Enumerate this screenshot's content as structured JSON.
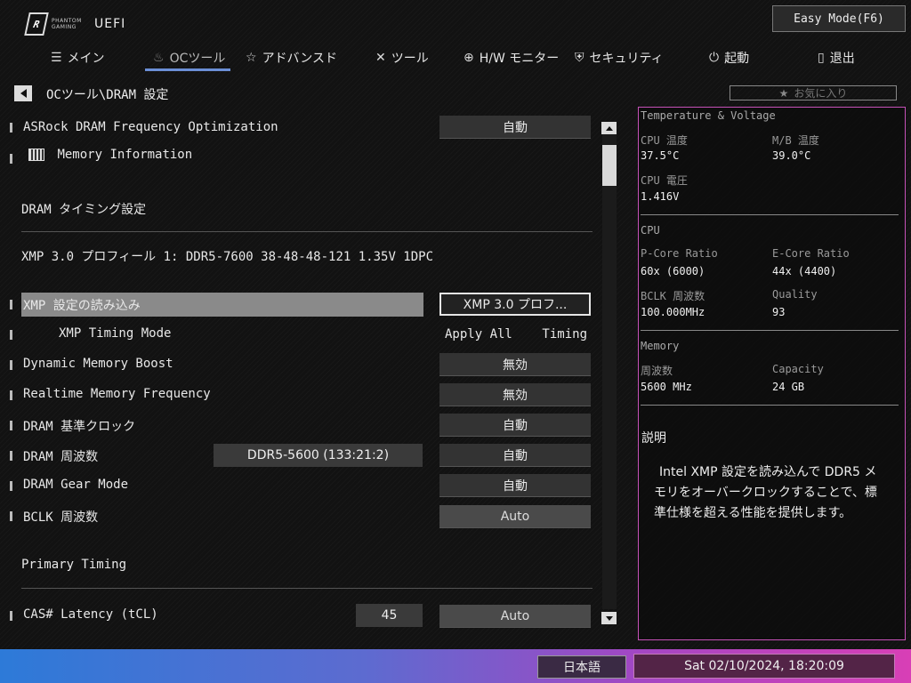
{
  "header": {
    "logo_small": "PHANTOM GAMING",
    "logo_big": "UEFI",
    "easy_mode": "Easy Mode(F6)"
  },
  "nav": {
    "main": "メイン",
    "oc_tools": "OCツール",
    "advanced": "アドバンスド",
    "tools": "ツール",
    "hw_monitor": "H/W モニター",
    "security": "セキュリティ",
    "boot": "起動",
    "exit": "退出"
  },
  "breadcrumb": "OCツール\\DRAM 設定",
  "favorites": "お気に入り",
  "settings": {
    "asrock_freq_opt": {
      "label": "ASRock DRAM Frequency Optimization",
      "value": "自動"
    },
    "memory_info": {
      "label": "Memory Information"
    },
    "dram_timing_section": "DRAM タイミング設定",
    "xmp_profile_text": "XMP 3.0 プロフィール 1: DDR5-7600 38-48-48-121 1.35V 1DPC",
    "load_xmp": {
      "label": "XMP 設定の読み込み",
      "value": "XMP 3.0 プロフ..."
    },
    "xmp_timing_mode": {
      "label": "XMP Timing Mode",
      "value_left": "Apply All",
      "value_right": "Timing"
    },
    "dynamic_mem_boost": {
      "label": "Dynamic Memory Boost",
      "value": "無効"
    },
    "realtime_mem_freq": {
      "label": "Realtime Memory Frequency",
      "value": "無効"
    },
    "dram_ref_clock": {
      "label": "DRAM 基準クロック",
      "value": "自動"
    },
    "dram_freq": {
      "label": "DRAM 周波数",
      "info": "DDR5-5600 (133:21:2)",
      "value": "自動"
    },
    "dram_gear_mode": {
      "label": "DRAM Gear Mode",
      "value": "自動"
    },
    "bclk_freq": {
      "label": "BCLK 周波数",
      "value": "Auto"
    },
    "primary_timing_section": "Primary Timing",
    "cas_latency": {
      "label": "CAS# Latency (tCL)",
      "info": "45",
      "value": "Auto"
    }
  },
  "panel": {
    "temp_voltage_title": "Temperature & Voltage",
    "cpu_temp_label": "CPU 温度",
    "cpu_temp": "37.5°C",
    "mb_temp_label": "M/B 温度",
    "mb_temp": "39.0°C",
    "cpu_voltage_label": "CPU 電圧",
    "cpu_voltage": "1.416V",
    "cpu_title": "CPU",
    "pcore_label": "P-Core Ratio",
    "pcore": "60x (6000)",
    "ecore_label": "E-Core Ratio",
    "ecore": "44x (4400)",
    "bclk_label": "BCLK 周波数",
    "bclk": "100.000MHz",
    "quality_label": "Quality",
    "quality": "93",
    "memory_title": "Memory",
    "mem_freq_label": "周波数",
    "mem_freq": "5600 MHz",
    "capacity_label": "Capacity",
    "capacity": "24 GB",
    "desc_title": "説明",
    "desc_text": "Intel XMP 設定を読み込んで DDR5 メモリをオーバークロックすることで、標準仕様を超える性能を提供します。"
  },
  "footer": {
    "language": "日本語",
    "datetime": "Sat 02/10/2024, 18:20:09"
  },
  "colors": {
    "panel_border": "#c651b8",
    "nav_underline": "#6b8fd6",
    "footer_start": "#2d7ad8",
    "footer_end": "#d83fb6"
  }
}
